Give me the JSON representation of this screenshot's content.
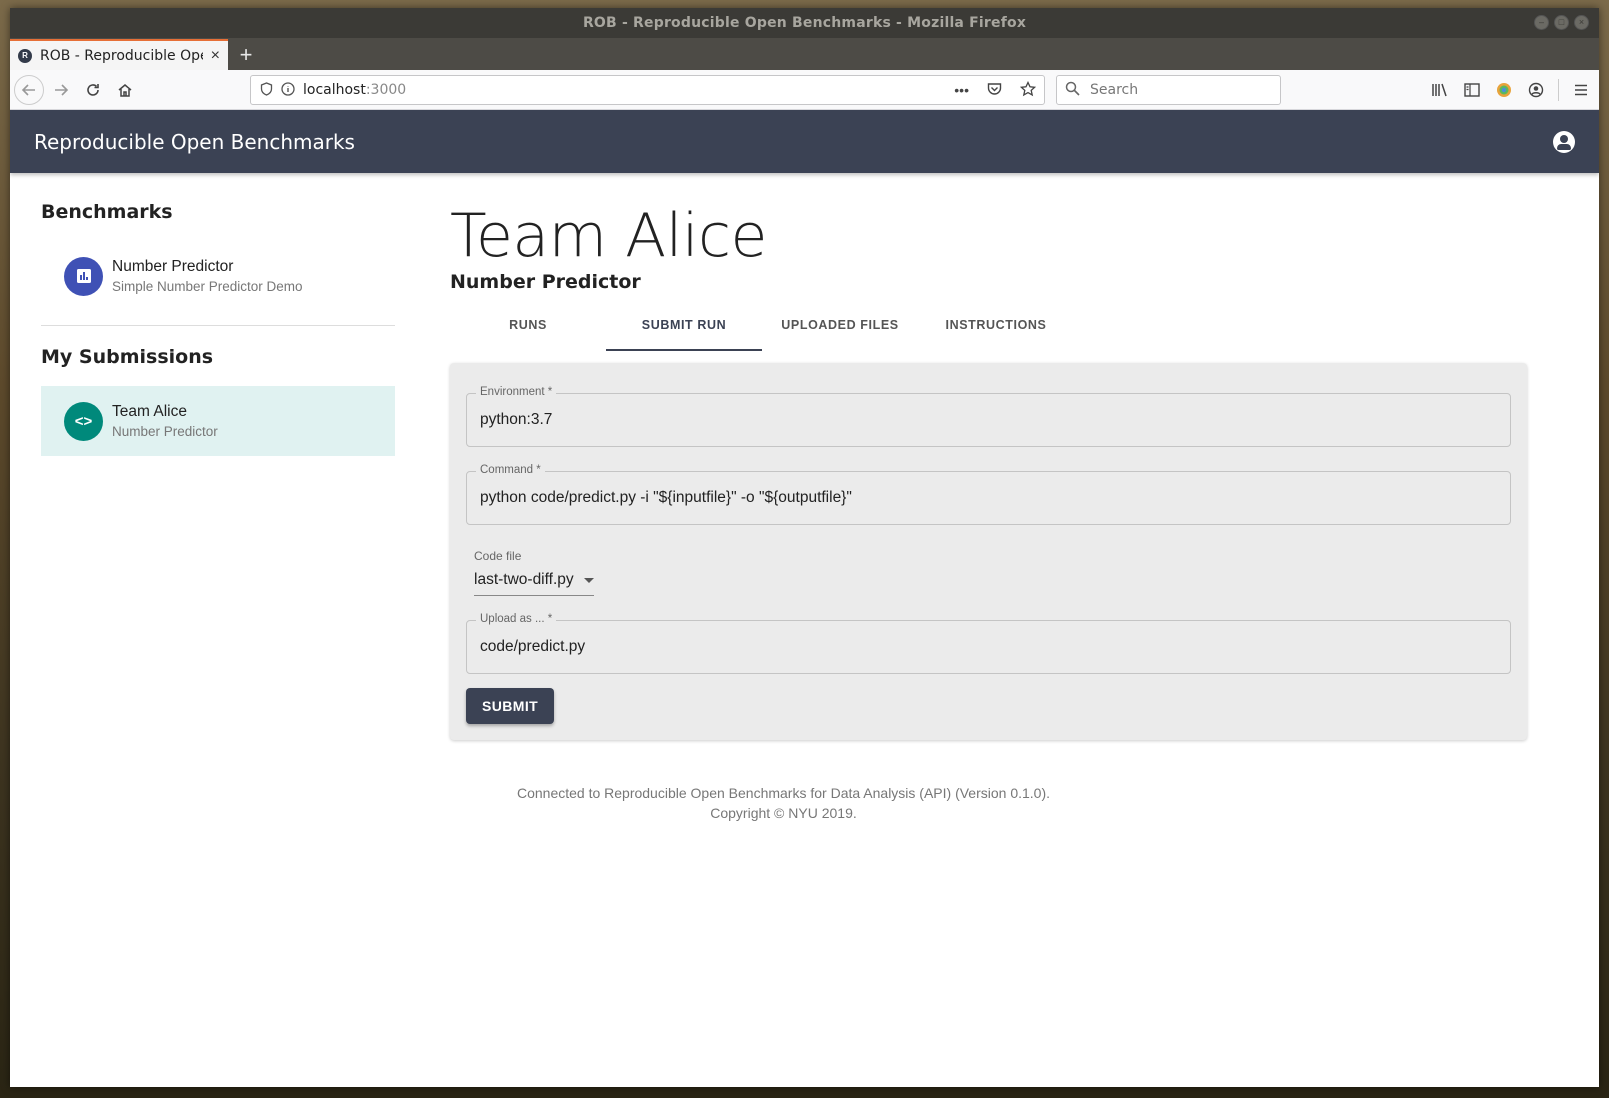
{
  "window": {
    "title": "ROB - Reproducible Open Benchmarks - Mozilla Firefox"
  },
  "browser": {
    "tab_title": "ROB - Reproducible Open Benchmarks",
    "favicon_letter": "R",
    "url_host": "localhost",
    "url_port": ":3000",
    "search_placeholder": "Search"
  },
  "app": {
    "title": "Reproducible Open Benchmarks",
    "brand_color": "#3b4254"
  },
  "sidebar": {
    "benchmarks_heading": "Benchmarks",
    "benchmarks": [
      {
        "name": "Number Predictor",
        "description": "Simple Number Predictor Demo",
        "icon": "bar-chart-icon"
      }
    ],
    "submissions_heading": "My Submissions",
    "submissions": [
      {
        "name": "Team Alice",
        "benchmark": "Number Predictor",
        "icon": "code-icon",
        "avatar_glyph": "<>"
      }
    ]
  },
  "main": {
    "team_title": "Team Alice",
    "benchmark_subtitle": "Number Predictor",
    "tabs": [
      {
        "label": "RUNS"
      },
      {
        "label": "SUBMIT RUN"
      },
      {
        "label": "UPLOADED FILES"
      },
      {
        "label": "INSTRUCTIONS"
      }
    ],
    "active_tab": "SUBMIT RUN",
    "form": {
      "environment_label": "Environment *",
      "environment_value": "python:3.7",
      "command_label": "Command *",
      "command_value": "python code/predict.py -i \"${inputfile}\" -o \"${outputfile}\"",
      "code_file_label": "Code file",
      "code_file_value": "last-two-diff.py",
      "upload_as_label": "Upload as ... *",
      "upload_as_value": "code/predict.py",
      "submit_label": "SUBMIT"
    }
  },
  "footer": {
    "line1": "Connected to Reproducible Open Benchmarks for Data Analysis (API) (Version 0.1.0).",
    "line2": "Copyright © NYU 2019."
  }
}
